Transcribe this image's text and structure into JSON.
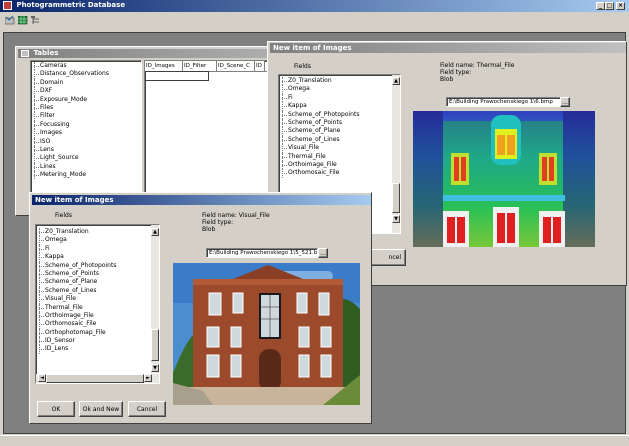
{
  "app": {
    "title": "Photogrammetric Database",
    "window_buttons": [
      "_",
      "□",
      "×"
    ]
  },
  "toolbar": {
    "icons": [
      "tables-icon",
      "grid-icon",
      "tree-icon"
    ]
  },
  "tables_window": {
    "title": "Tables",
    "items": [
      "Cameras",
      "Distance_Observations",
      "Domain",
      "DXF",
      "Exposure_Mode",
      "Files",
      "Filter",
      "Focussing",
      "Images",
      "ISO",
      "Lens",
      "Light_Source",
      "Lines",
      "Metering_Mode"
    ],
    "columns": [
      "ID_Images",
      "ID_Filter",
      "ID_Scene_C",
      "ID"
    ]
  },
  "back_dialog": {
    "title": "New item of Images",
    "fields_header": "Fields",
    "fields": [
      "Z0_Translation",
      "Omega",
      "Fi",
      "Kappa",
      "Scheme_of_Photopoints",
      "Scheme_of_Points",
      "Scheme_of_Plane",
      "Scheme_of_Lines",
      "Visual_File",
      "Thermal_File",
      "Orthoimage_File",
      "Orthomosaic_File"
    ],
    "field_name": "Field name: Thermal_File",
    "field_type": "Field type:",
    "field_type_value": "Blob",
    "path": "E:\\Building Prawochenskiego 1\\6.bmp",
    "browse": "...",
    "cancel_partial": "ncel"
  },
  "front_dialog": {
    "title": "New item of Images",
    "fields_header": "Fields",
    "fields": [
      "Z0_Translation",
      "Omega",
      "Fi",
      "Kappa",
      "Scheme_of_Photopoints",
      "Scheme_of_Points",
      "Scheme_of_Plane",
      "Scheme_of_Lines",
      "Visual_File",
      "Thermal_File",
      "Orthoimage_File",
      "Orthomosaic_File",
      "Orthophotomap_File",
      "ID_Sensor",
      "ID_Lens"
    ],
    "field_name": "Field name: Visual_File",
    "field_type": "Field type:",
    "field_type_value": "Blob",
    "path": "E:\\Building Prawochenskiego 1\\5_521.b",
    "browse": "...",
    "buttons": {
      "ok": "OK",
      "ok_new": "Ok and New",
      "cancel": "Cancel"
    }
  },
  "colors": {
    "title_active": "#0a246a",
    "title_gradient_end": "#a6caf0",
    "face": "#d4d0c8"
  }
}
